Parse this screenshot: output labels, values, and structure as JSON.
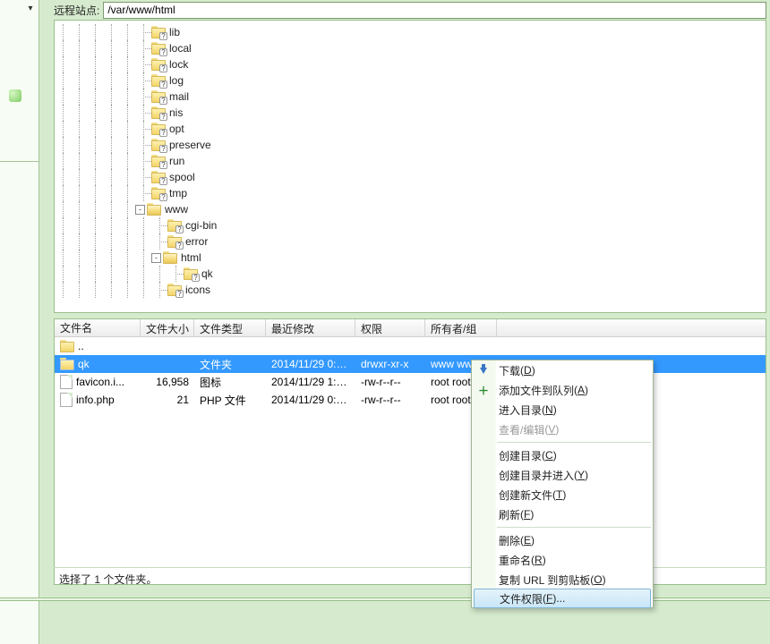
{
  "remote": {
    "label": "远程站点:",
    "path": "/var/www/html"
  },
  "tree": [
    {
      "depth": 5,
      "name": "lib",
      "badge": "?"
    },
    {
      "depth": 5,
      "name": "local",
      "badge": "?"
    },
    {
      "depth": 5,
      "name": "lock",
      "badge": "?"
    },
    {
      "depth": 5,
      "name": "log",
      "badge": "?"
    },
    {
      "depth": 5,
      "name": "mail",
      "badge": "?"
    },
    {
      "depth": 5,
      "name": "nis",
      "badge": "?"
    },
    {
      "depth": 5,
      "name": "opt",
      "badge": "?"
    },
    {
      "depth": 5,
      "name": "preserve",
      "badge": "?"
    },
    {
      "depth": 5,
      "name": "run",
      "badge": "?"
    },
    {
      "depth": 5,
      "name": "spool",
      "badge": "?"
    },
    {
      "depth": 5,
      "name": "tmp",
      "badge": "?"
    },
    {
      "depth": 5,
      "name": "www",
      "expander": "-",
      "open": true
    },
    {
      "depth": 6,
      "name": "cgi-bin",
      "badge": "?"
    },
    {
      "depth": 6,
      "name": "error",
      "badge": "?"
    },
    {
      "depth": 6,
      "name": "html",
      "expander": "-",
      "open": true
    },
    {
      "depth": 7,
      "name": "qk",
      "badge": "?"
    },
    {
      "depth": 6,
      "name": "icons",
      "badge": "?",
      "cut": true
    }
  ],
  "columns": {
    "name": "文件名",
    "size": "文件大小",
    "type": "文件类型",
    "date": "最近修改",
    "perm": "权限",
    "owner": "所有者/组"
  },
  "rows": [
    {
      "name": "..",
      "kind": "up",
      "size": "",
      "type": "",
      "date": "",
      "perm": "",
      "owner": ""
    },
    {
      "name": "qk",
      "kind": "folder",
      "selected": true,
      "size": "",
      "type": "文件夹",
      "date": "2014/11/29 0:5...",
      "perm": "drwxr-xr-x",
      "owner": "www www"
    },
    {
      "name": "favicon.i...",
      "kind": "file",
      "size": "16,958",
      "type": "图标",
      "date": "2014/11/29 1:2...",
      "perm": "-rw-r--r--",
      "owner": "root root"
    },
    {
      "name": "info.php",
      "kind": "file",
      "size": "21",
      "type": "PHP 文件",
      "date": "2014/11/29 0:2...",
      "perm": "-rw-r--r--",
      "owner": "root root"
    }
  ],
  "status": "选择了 1 个文件夹。",
  "menu": [
    {
      "label": "下载",
      "accel": "D",
      "icon": "download"
    },
    {
      "label": "添加文件到队列",
      "accel": "A",
      "icon": "add"
    },
    {
      "label": "进入目录",
      "accel": "N"
    },
    {
      "label": "查看/编辑",
      "accel": "V",
      "disabled": true
    },
    {
      "sep": true
    },
    {
      "label": "创建目录",
      "accel": "C"
    },
    {
      "label": "创建目录并进入",
      "accel": "Y"
    },
    {
      "label": "创建新文件",
      "accel": "T"
    },
    {
      "label": "刷新",
      "accel": "F"
    },
    {
      "sep": true
    },
    {
      "label": "删除",
      "accel": "E"
    },
    {
      "label": "重命名",
      "accel": "R"
    },
    {
      "label": "复制 URL 到剪贴板",
      "accel": "O"
    },
    {
      "label": "文件权限",
      "accel": "F",
      "suffix": "...",
      "hover": true
    }
  ]
}
